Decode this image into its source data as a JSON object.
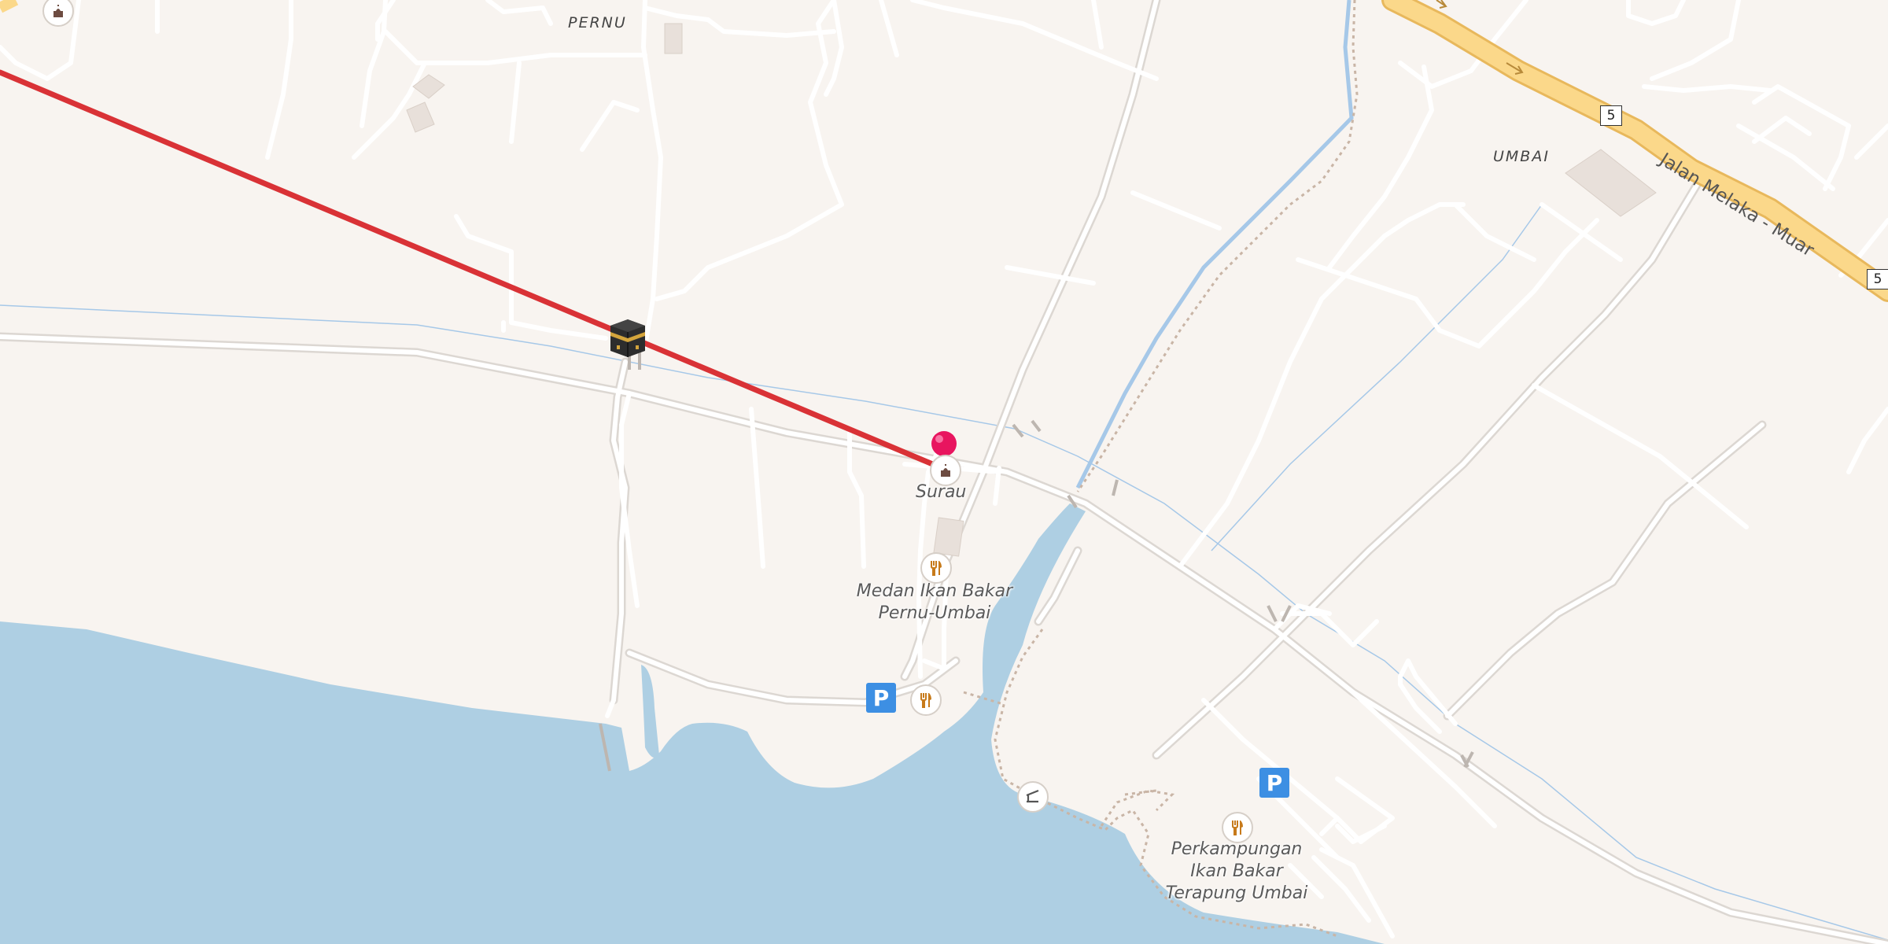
{
  "map": {
    "places": {
      "pernu": "PERNU",
      "umbai": "UMBAI"
    },
    "roads": {
      "main_road": "Jalan Melaka - Muar",
      "route_number": "5"
    },
    "pois": {
      "surau": "Surau",
      "medan_ikan_bakar": "Medan Ikan Bakar Pernu-Umbai",
      "perkampungan": "Perkampungan Ikan Bakar Terapung Umbai"
    },
    "icons": {
      "mosque": "mosque-icon",
      "kaaba": "kaaba-icon",
      "restaurant": "restaurant-icon",
      "parking": "parking-icon",
      "shelter": "shelter-icon",
      "pin": "location-pin-icon"
    },
    "parking_symbol": "P",
    "colors": {
      "land": "#f8f4f0",
      "water": "#aecfe3",
      "road": "#ffffff",
      "road_casing": "#dcd7d2",
      "trunk": "#fbd88a",
      "trunk_casing": "#e8b85c",
      "qibla_line": "#d93236",
      "pin": "#e8155f"
    }
  }
}
